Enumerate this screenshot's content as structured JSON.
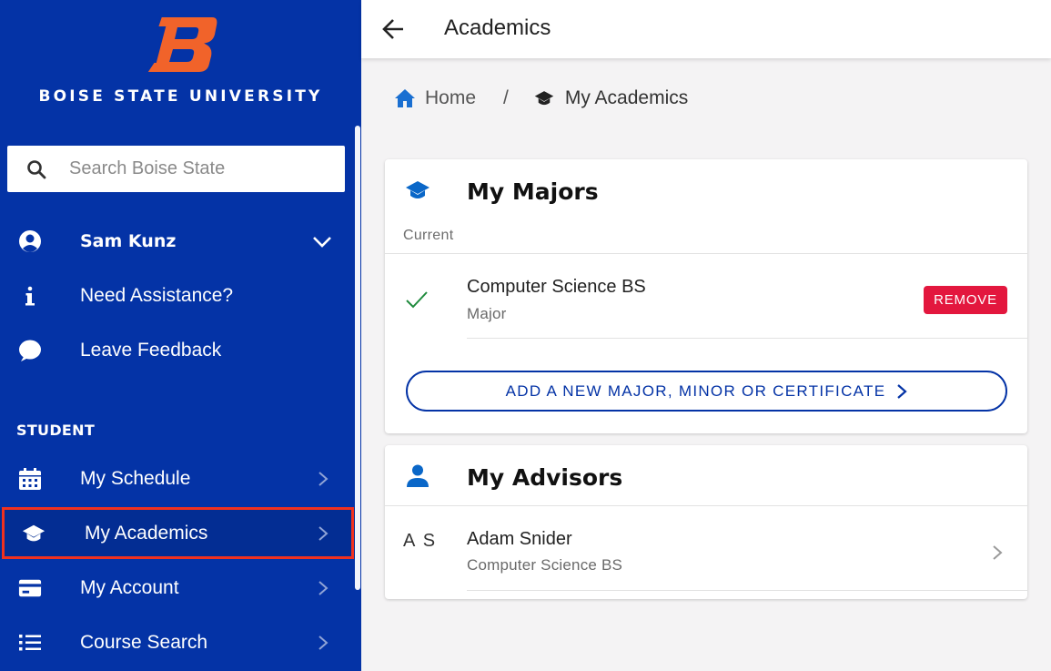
{
  "sidebar": {
    "university_name": "BOISE STATE UNIVERSITY",
    "logo_letter": "B",
    "search": {
      "placeholder": "Search Boise State",
      "value": ""
    },
    "user": {
      "name": "Sam Kunz",
      "icon": "user-circle-icon"
    },
    "links": [
      {
        "label": "Need Assistance?",
        "icon": "info-icon"
      },
      {
        "label": "Leave Feedback",
        "icon": "chat-bubble-icon"
      }
    ],
    "section_label": "STUDENT",
    "items": [
      {
        "label": "My Schedule",
        "icon": "calendar-icon"
      },
      {
        "label": "My Academics",
        "icon": "graduation-cap-icon",
        "active": true
      },
      {
        "label": "My Account",
        "icon": "credit-card-icon"
      },
      {
        "label": "Course Search",
        "icon": "list-icon"
      }
    ]
  },
  "topbar": {
    "title": "Academics"
  },
  "breadcrumb": {
    "home": "Home",
    "separator": "/",
    "current": "My Academics"
  },
  "majors_card": {
    "title": "My Majors",
    "subheader": "Current",
    "items": [
      {
        "name": "Computer Science BS",
        "type": "Major",
        "status": "checked"
      }
    ],
    "remove_label": "REMOVE",
    "add_label": "ADD A NEW MAJOR, MINOR OR CERTIFICATE"
  },
  "advisors_card": {
    "title": "My Advisors",
    "advisors": [
      {
        "initials": "A S",
        "name": "Adam Snider",
        "program": "Computer Science BS"
      }
    ]
  },
  "colors": {
    "brand_blue": "#0433a6",
    "brand_orange": "#f1632a",
    "remove_red": "#e3173e",
    "check_green": "#1e8a3c",
    "highlight_outline": "#f0311f",
    "icon_blue": "#0a67c8"
  }
}
